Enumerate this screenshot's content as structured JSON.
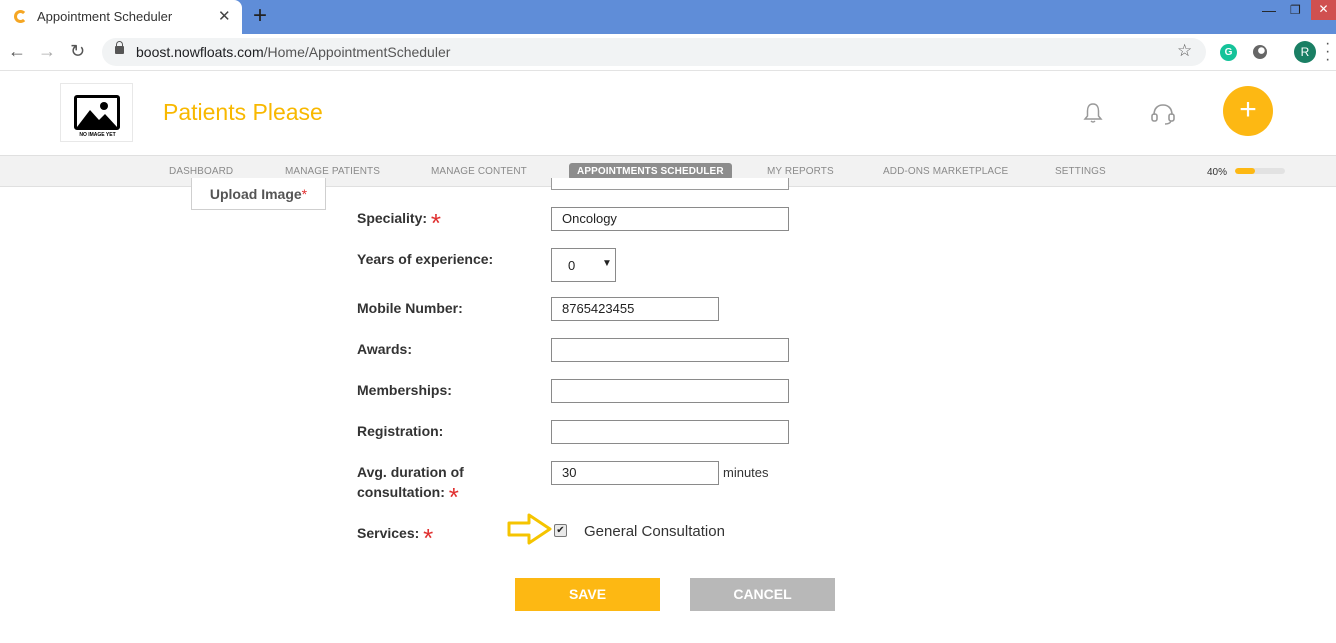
{
  "browser": {
    "tab_title": "Appointment Scheduler",
    "tab_close": "✕",
    "new_tab": "+",
    "url_host": "boost.nowfloats.com",
    "url_path": "/Home/AppointmentScheduler",
    "profile_initial": "R",
    "extension_g": "G"
  },
  "header": {
    "logo_text": "NO IMAGE YET",
    "brand": "Patients Please",
    "fab_label": "+"
  },
  "nav": {
    "items": [
      {
        "label": "DASHBOARD",
        "active": false
      },
      {
        "label": "MANAGE PATIENTS",
        "active": false
      },
      {
        "label": "MANAGE CONTENT",
        "active": false
      },
      {
        "label": "APPOINTMENTS SCHEDULER",
        "active": true
      },
      {
        "label": "MY REPORTS",
        "active": false
      },
      {
        "label": "ADD-ONS MARKETPLACE",
        "active": false
      },
      {
        "label": "SETTINGS",
        "active": false
      }
    ],
    "progress_label": "40%",
    "progress_value": 0.4
  },
  "form": {
    "upload_label": "Upload Image",
    "required_mark": "*",
    "speciality_label": "Speciality:",
    "speciality_value": "Oncology",
    "experience_label": "Years of experience:",
    "experience_value": "0",
    "mobile_label": "Mobile Number:",
    "mobile_value": "8765423455",
    "awards_label": "Awards:",
    "awards_value": "",
    "memberships_label": "Memberships:",
    "memberships_value": "",
    "registration_label": "Registration:",
    "registration_value": "",
    "duration_label_line1": "Avg. duration of",
    "duration_label_line2": "consultation:",
    "duration_value": "30",
    "duration_unit": "minutes",
    "services_label": "Services:",
    "service_option": "General Consultation",
    "service_checked": true,
    "save_label": "SAVE",
    "cancel_label": "CANCEL"
  },
  "colors": {
    "accent": "#fdb813",
    "brand": "#f8b800",
    "required": "#e03030",
    "tabbar": "#5f8dd8"
  }
}
